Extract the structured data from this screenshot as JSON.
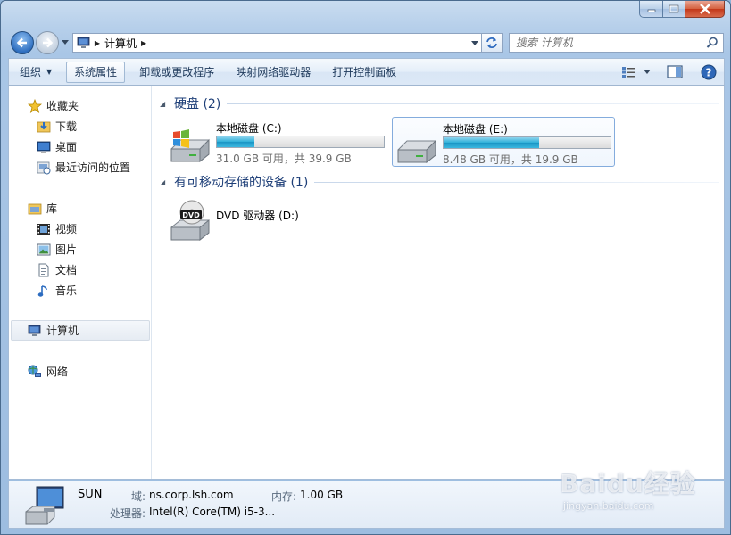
{
  "window": {
    "caption_buttons": [
      "minimize",
      "maximize",
      "close"
    ]
  },
  "address": {
    "path": [
      "计算机"
    ]
  },
  "search": {
    "placeholder": "搜索 计算机"
  },
  "toolbar": {
    "organize": "组织",
    "system_properties": "系统属性",
    "uninstall": "卸载或更改程序",
    "map_drive": "映射网络驱动器",
    "control_panel": "打开控制面板"
  },
  "sidebar": {
    "favorites": {
      "label": "收藏夹",
      "items": [
        {
          "label": "下载",
          "icon": "download-folder-icon"
        },
        {
          "label": "桌面",
          "icon": "desktop-icon"
        },
        {
          "label": "最近访问的位置",
          "icon": "recent-places-icon"
        }
      ]
    },
    "libraries": {
      "label": "库",
      "items": [
        {
          "label": "视频",
          "icon": "video-icon"
        },
        {
          "label": "图片",
          "icon": "pictures-icon"
        },
        {
          "label": "文档",
          "icon": "documents-icon"
        },
        {
          "label": "音乐",
          "icon": "music-icon"
        }
      ]
    },
    "computer": {
      "label": "计算机"
    },
    "network": {
      "label": "网络"
    }
  },
  "main": {
    "hard_disks": {
      "title": "硬盘 (2)",
      "drives": [
        {
          "name": "本地磁盘 (C:)",
          "free": "31.0 GB 可用，共 39.9 GB",
          "used_fraction": 0.223
        },
        {
          "name": "本地磁盘 (E:)",
          "free": "8.48 GB 可用，共 19.9 GB",
          "used_fraction": 0.574
        }
      ]
    },
    "removable": {
      "title": "有可移动存储的设备 (1)",
      "drives": [
        {
          "name": "DVD 驱动器 (D:)"
        }
      ]
    }
  },
  "details": {
    "name": "SUN",
    "domain_label": "域:",
    "domain_value": "ns.corp.lsh.com",
    "memory_label": "内存:",
    "memory_value": "1.00 GB",
    "cpu_label": "处理器:",
    "cpu_value": "Intel(R) Core(TM) i5-3..."
  },
  "watermark": {
    "logo": "Baidu经验",
    "url": "jingyan.baidu.com"
  },
  "colors": {
    "accent": "#1e3f78",
    "bar_fill": "#2eb0d8",
    "frame": "#a9c6e6"
  }
}
